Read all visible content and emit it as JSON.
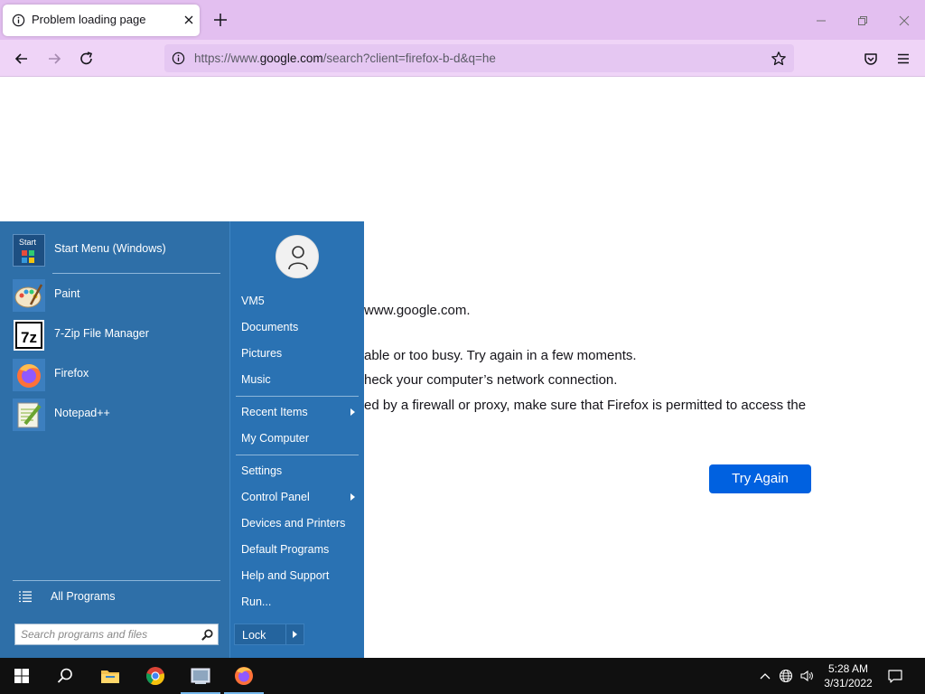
{
  "browser": {
    "tab": {
      "title": "Problem loading page"
    },
    "url": {
      "prefix": "https://www.",
      "host": "google.com",
      "rest": "/search?client=firefox-b-d&q=he"
    }
  },
  "error_page": {
    "line1": "www.google.com.",
    "line2": "able or too busy. Try again in a few moments.",
    "line3": "heck your computer’s network connection.",
    "line4": "ed by a firewall or proxy, make sure that Firefox is permitted to access the",
    "try_again": "Try Again"
  },
  "start_menu": {
    "pinned": [
      {
        "label": "Start Menu (Windows)",
        "icon": "start-menu-app-icon"
      },
      {
        "label": "Paint",
        "icon": "paint-icon"
      },
      {
        "label": "7-Zip File Manager",
        "icon": "7zip-icon"
      },
      {
        "label": "Firefox",
        "icon": "firefox-icon"
      },
      {
        "label": "Notepad++",
        "icon": "notepadpp-icon"
      }
    ],
    "pinned_first_icon_text": "Start",
    "all_programs": "All Programs",
    "search_placeholder": "Search programs and files",
    "right": {
      "items": [
        "VM5",
        "Documents",
        "Pictures",
        "Music",
        "Recent Items",
        "My Computer",
        "Settings",
        "Control Panel",
        "Devices and Printers",
        "Default Programs",
        "Help and Support",
        "Run..."
      ],
      "lock": "Lock"
    }
  },
  "taskbar": {
    "time": "5:28 AM",
    "date": "3/31/2022",
    "apps": [
      "windows-start-icon",
      "search-icon",
      "file-explorer-icon",
      "chrome-icon",
      "start-menu-app-icon",
      "firefox-icon"
    ]
  },
  "colors": {
    "tabstrip": "#e3bff0",
    "navbar": "#efd4f7",
    "start_menu_blue": "#2e6fa8",
    "try_again": "#0061e0"
  }
}
